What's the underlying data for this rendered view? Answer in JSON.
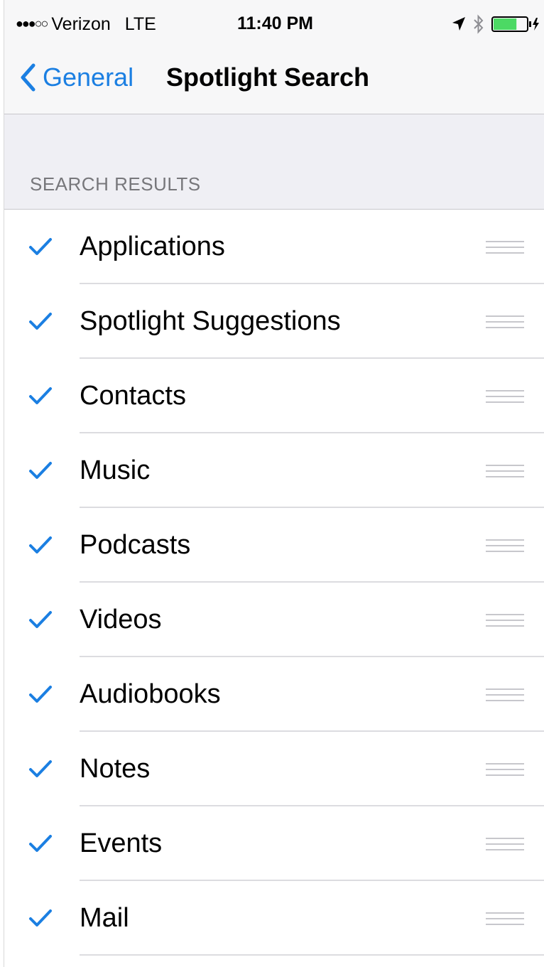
{
  "status_bar": {
    "signal": "●●●○○",
    "carrier": "Verizon",
    "network": "LTE",
    "time": "11:40 PM",
    "icons": [
      "location-arrow-icon",
      "bluetooth-icon",
      "battery-charging-icon"
    ],
    "battery_level_fraction": 0.7
  },
  "nav": {
    "back_label": "General",
    "title": "Spotlight Search"
  },
  "section": {
    "header": "SEARCH RESULTS"
  },
  "colors": {
    "accent": "#1b7fe2",
    "background_group": "#efeff4",
    "bar_background": "#f7f7f8",
    "separator": "#dcdce0",
    "section_header_text": "#77777b",
    "battery": "#4cd964"
  },
  "items": [
    {
      "label": "Applications",
      "checked": true
    },
    {
      "label": "Spotlight Suggestions",
      "checked": true
    },
    {
      "label": "Contacts",
      "checked": true
    },
    {
      "label": "Music",
      "checked": true
    },
    {
      "label": "Podcasts",
      "checked": true
    },
    {
      "label": "Videos",
      "checked": true
    },
    {
      "label": "Audiobooks",
      "checked": true
    },
    {
      "label": "Notes",
      "checked": true
    },
    {
      "label": "Events",
      "checked": true
    },
    {
      "label": "Mail",
      "checked": true
    }
  ]
}
